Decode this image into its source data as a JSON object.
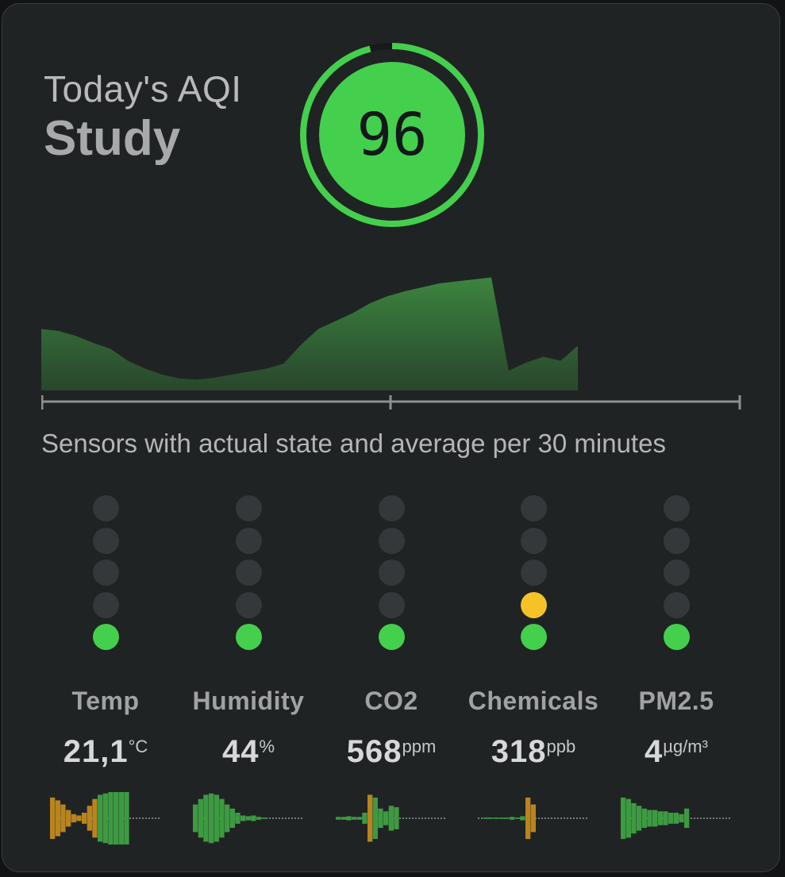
{
  "card": {
    "title": "Today's AQI",
    "room": "Study",
    "aqi_value": "96",
    "aqi_level": 0.96,
    "subtitle": "Sensors with actual state and average per 30 minutes"
  },
  "colors": {
    "good": "#44d04c",
    "moderate": "#f5c228",
    "warning": "#e07b1c",
    "inactive": "#35383a",
    "history_fill": "#3a7a3e"
  },
  "history": {
    "values": [
      62,
      60,
      55,
      48,
      42,
      30,
      22,
      16,
      12,
      11,
      13,
      16,
      19,
      22,
      27,
      46,
      62,
      70,
      78,
      88,
      95,
      100,
      104,
      108,
      110,
      112,
      114,
      20,
      28,
      34,
      30,
      45
    ]
  },
  "sensors": [
    {
      "id": "temp",
      "name": "Temp",
      "value": "21,1",
      "unit": "°C",
      "level": 1,
      "level_color": "good"
    },
    {
      "id": "humidity",
      "name": "Humidity",
      "value": "44",
      "unit": "%",
      "level": 1,
      "level_color": "good"
    },
    {
      "id": "co2",
      "name": "CO2",
      "value": "568",
      "unit": "ppm",
      "level": 1,
      "level_color": "good"
    },
    {
      "id": "chemicals",
      "name": "Chemicals",
      "value": "318",
      "unit": "ppb",
      "level": 2,
      "level_color": "moderate"
    },
    {
      "id": "pm25",
      "name": "PM2.5",
      "value": "4",
      "unit": "µg/m³",
      "level": 1,
      "level_color": "good"
    }
  ],
  "sparklines": [
    {
      "profile": [
        30,
        26,
        20,
        12,
        6,
        4,
        8,
        18,
        28,
        34,
        36,
        38,
        38,
        38,
        38
      ],
      "warn": [
        0,
        1,
        2,
        3,
        4,
        5,
        6,
        7,
        8
      ]
    },
    {
      "profile": [
        20,
        28,
        34,
        36,
        34,
        28,
        20,
        14,
        8,
        4,
        3,
        4,
        2,
        1,
        0
      ],
      "warn": []
    },
    {
      "profile": [
        2,
        2,
        3,
        2,
        2,
        8,
        34,
        30,
        14,
        10,
        18,
        16,
        0,
        0,
        0
      ],
      "warn": [
        6
      ]
    },
    {
      "profile": [
        0,
        1,
        1,
        1,
        1,
        1,
        2,
        1,
        3,
        30,
        20,
        0,
        0,
        0,
        0
      ],
      "warn": [
        9,
        10
      ]
    },
    {
      "profile": [
        30,
        28,
        22,
        18,
        14,
        12,
        12,
        10,
        10,
        8,
        8,
        6,
        14,
        0,
        0
      ],
      "warn": []
    }
  ]
}
